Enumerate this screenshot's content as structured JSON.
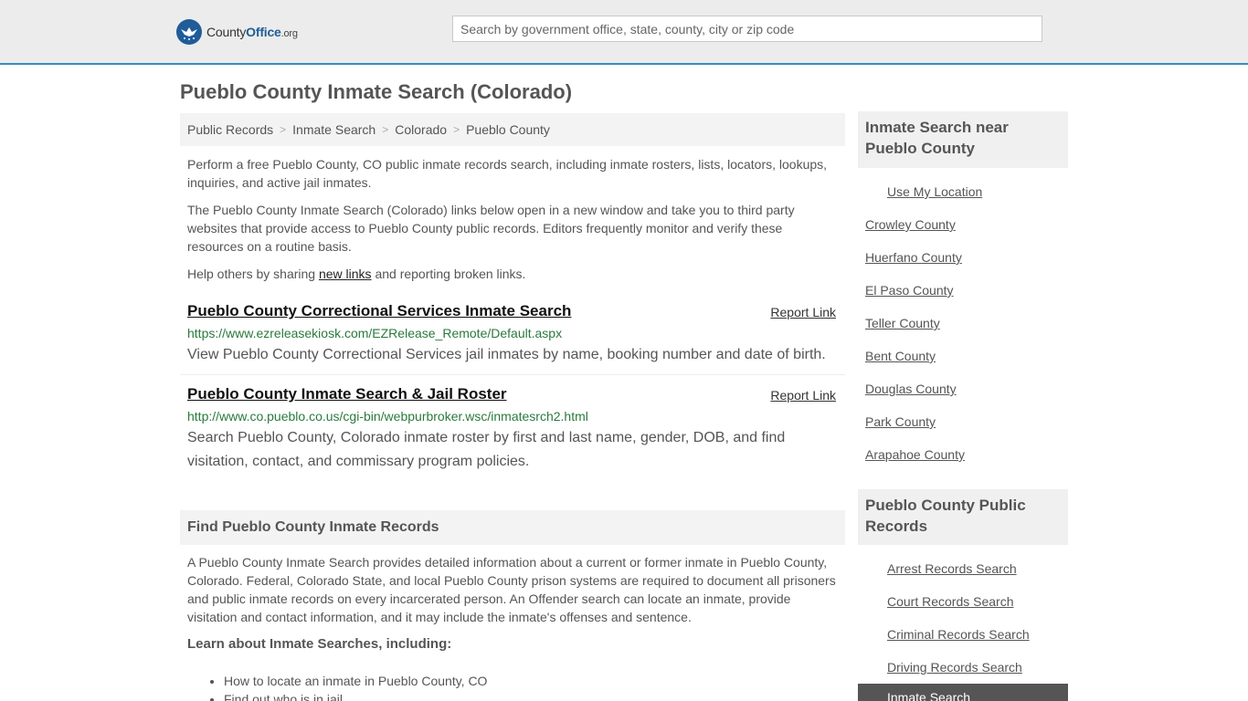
{
  "header": {
    "logo_word1": "County",
    "logo_word2": "Office",
    "logo_tld": ".org",
    "search_placeholder": "Search by government office, state, county, city or zip code"
  },
  "page": {
    "title": "Pueblo County Inmate Search (Colorado)"
  },
  "breadcrumb": [
    "Public Records",
    "Inmate Search",
    "Colorado",
    "Pueblo County"
  ],
  "intro": {
    "p1": "Perform a free Pueblo County, CO public inmate records search, including inmate rosters, lists, locators, lookups, inquiries, and active jail inmates.",
    "p2": "The Pueblo County Inmate Search (Colorado) links below open in a new window and take you to third party websites that provide access to Pueblo County public records. Editors frequently monitor and verify these resources on a routine basis.",
    "p3_before": "Help others by sharing ",
    "p3_link": "new links",
    "p3_after": " and reporting broken links."
  },
  "results": [
    {
      "title": "Pueblo County Correctional Services Inmate Search",
      "report": "Report Link",
      "url": "https://www.ezreleasekiosk.com/EZRelease_Remote/Default.aspx",
      "desc": "View Pueblo County Correctional Services jail inmates by name, booking number and date of birth."
    },
    {
      "title": "Pueblo County Inmate Search & Jail Roster",
      "report": "Report Link",
      "url": "http://www.co.pueblo.co.us/cgi-bin/webpurbroker.wsc/inmatesrch2.html",
      "desc": "Search Pueblo County, Colorado inmate roster by first and last name, gender, DOB, and find visitation, contact, and commissary program policies."
    }
  ],
  "find_section": {
    "heading": "Find Pueblo County Inmate Records",
    "body": "A Pueblo County Inmate Search provides detailed information about a current or former inmate in Pueblo County, Colorado. Federal, Colorado State, and local Pueblo County prison systems are required to document all prisoners and public inmate records on every incarcerated person. An Offender search can locate an inmate, provide visitation and contact information, and it may include the inmate's offenses and sentence.",
    "learn": "Learn about Inmate Searches, including:",
    "bullets": [
      "How to locate an inmate in Pueblo County, CO",
      "Find out who is in jail"
    ]
  },
  "sidebar": {
    "near_heading": "Inmate Search near Pueblo County",
    "use_location": "Use My Location",
    "counties": [
      "Crowley County",
      "Huerfano County",
      "El Paso County",
      "Teller County",
      "Bent County",
      "Douglas County",
      "Park County",
      "Arapahoe County"
    ],
    "records_heading": "Pueblo County Public Records",
    "records": [
      "Arrest Records Search",
      "Court Records Search",
      "Criminal Records Search",
      "Driving Records Search"
    ],
    "active": "Inmate Search"
  }
}
